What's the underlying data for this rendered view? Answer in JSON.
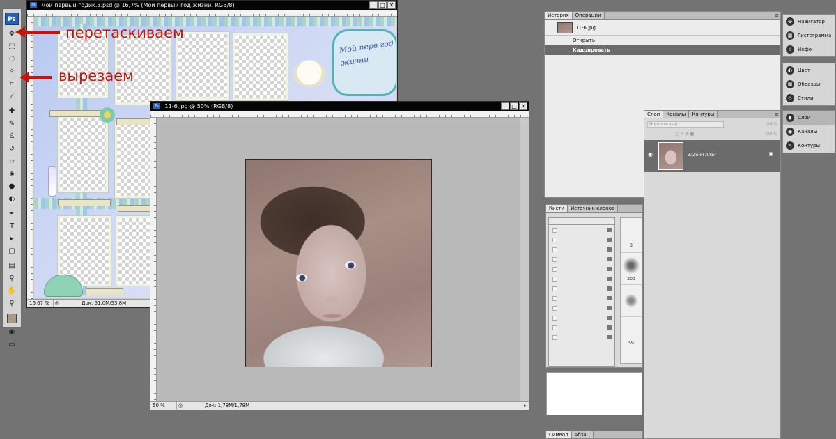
{
  "tools": {
    "logo": "Ps",
    "icons": [
      "move-icon",
      "marquee-icon",
      "lasso-icon",
      "magic-wand-icon",
      "crop-icon",
      "slice-icon",
      "healing-icon",
      "brush-icon",
      "stamp-icon",
      "history-brush-icon",
      "eraser-icon",
      "bucket-icon",
      "blur-icon",
      "dodge-icon",
      "pen-icon",
      "type-icon",
      "path-select-icon",
      "shape-icon",
      "notes-icon",
      "eyedropper-icon",
      "hand-icon",
      "zoom-icon"
    ]
  },
  "doc1": {
    "title": "мой первый годик.3.psd @ 16,7% (Мой первый год жизни, RGB/8)",
    "zoom": "16,67 %",
    "doc_size": "Док: 51,0M/53,8M",
    "plaque_text": "Мой перв год жизни"
  },
  "doc2": {
    "title": "11-6.jpg @ 50% (RGB/8)",
    "zoom": "50 %",
    "doc_size": "Док: 1,78M/1,78M"
  },
  "annotations": {
    "drag": "перетаскиваем",
    "cut": "вырезаем",
    "color": "#c0160d"
  },
  "history_panel": {
    "tabs": [
      "История",
      "Операции"
    ],
    "snapshot": "11-6.jpg",
    "items": [
      {
        "label": "Открыть",
        "selected": false
      },
      {
        "label": "Кадрировать",
        "selected": true
      }
    ]
  },
  "dock_top": {
    "items": [
      "Навигатор",
      "Гистограмма",
      "Инфо"
    ]
  },
  "dock_mid": {
    "items": [
      "Цвет",
      "Образцы",
      "Стили"
    ]
  },
  "dock_layers": {
    "items": [
      "Слои",
      "Каналы",
      "Контуры"
    ]
  },
  "layers_panel": {
    "tabs": [
      "Слои",
      "Каналы",
      "Контуры"
    ],
    "blend_mode": "Нормальный",
    "opacity": "100%",
    "fill": "100%",
    "layer_name": "Задний план"
  },
  "brushes_panel": {
    "tabs": [
      "Кисти",
      "Источник клонов"
    ],
    "sizes": [
      "3",
      "200",
      "59"
    ]
  },
  "character_panel": {
    "tabs": [
      "Символ",
      "Абзац"
    ]
  },
  "window_buttons": {
    "minimize": "_",
    "maximize": "□",
    "close": "✕"
  }
}
